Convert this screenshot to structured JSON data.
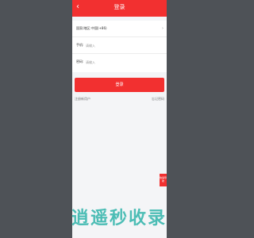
{
  "header": {
    "back_glyph": "‹",
    "title": "登录"
  },
  "form": {
    "region_label": "国家/地区:",
    "region_value": "中国(+86)",
    "phone_label": "手机:",
    "phone_placeholder": "请输入",
    "password_label": "密码:",
    "password_placeholder": "请输入"
  },
  "actions": {
    "login_label": "登录",
    "register_label": "注册新用户",
    "forgot_label": "忘记密码"
  },
  "side_tab": {
    "label": "快速导航"
  },
  "watermark": {
    "text": "逍遥秒收录"
  },
  "colors": {
    "accent": "#f23030",
    "page_bg": "#4e5257",
    "watermark": "#3ab7ae"
  }
}
